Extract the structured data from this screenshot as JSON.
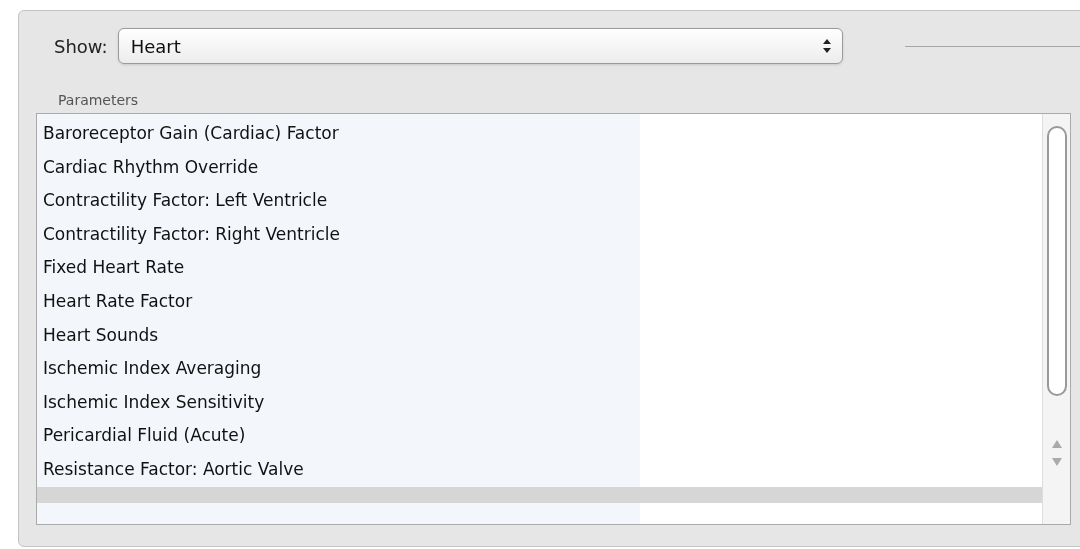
{
  "show": {
    "label": "Show:",
    "value": "Heart"
  },
  "parameters": {
    "title": "Parameters",
    "items": [
      "Baroreceptor Gain (Cardiac) Factor",
      "Cardiac Rhythm Override",
      "Contractility Factor: Left Ventricle",
      "Contractility Factor: Right Ventricle",
      "Fixed Heart Rate",
      "Heart Rate Factor",
      "Heart Sounds",
      "Ischemic Index Averaging",
      "Ischemic Index Sensitivity",
      "Pericardial Fluid (Acute)",
      "Resistance Factor: Aortic Valve"
    ]
  }
}
